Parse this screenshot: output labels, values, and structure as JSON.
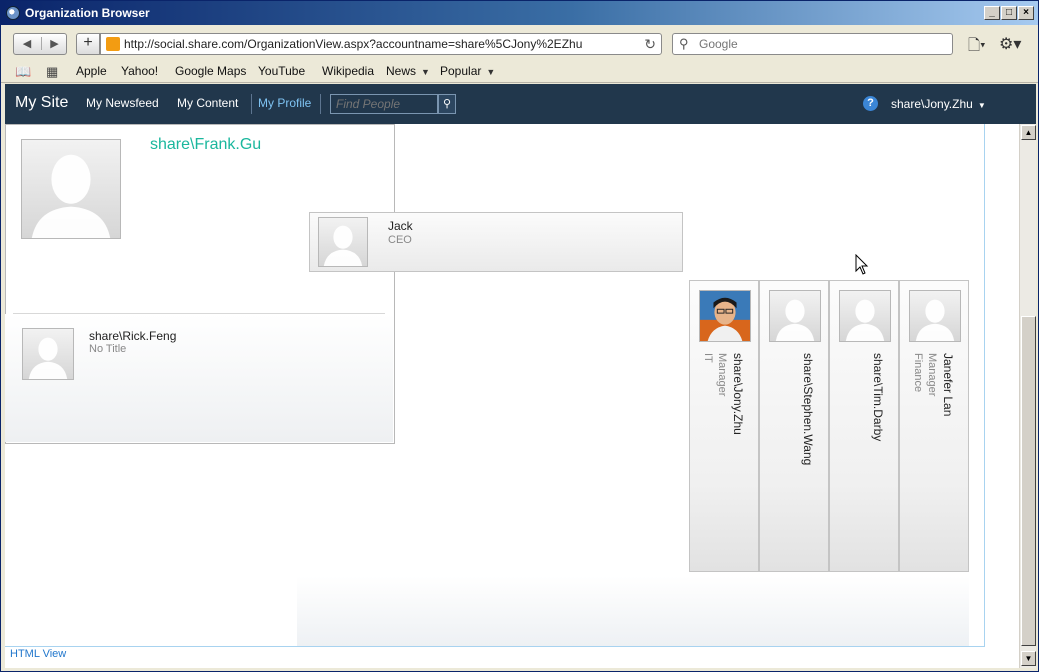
{
  "window": {
    "title": "Organization Browser",
    "controls": [
      "_",
      "□",
      "×"
    ]
  },
  "toolbar": {
    "url": "http://social.share.com/OrganizationView.aspx?accountname=share%5CJony%2EZhu",
    "search_placeholder": "Google"
  },
  "bookmarks": [
    {
      "label": "Apple"
    },
    {
      "label": "Yahoo!"
    },
    {
      "label": "Google Maps"
    },
    {
      "label": "YouTube"
    },
    {
      "label": "Wikipedia"
    },
    {
      "label": "News",
      "dropdown": true
    },
    {
      "label": "Popular",
      "dropdown": true
    }
  ],
  "sp_nav": {
    "site_title": "My Site",
    "links": [
      "My Newsfeed",
      "My Content",
      "My Profile"
    ],
    "active_link": "My Profile",
    "find_placeholder": "Find People",
    "user": "share\\Jony.Zhu"
  },
  "org": {
    "manager": {
      "name": "Jack",
      "title": "CEO"
    },
    "focus": {
      "name": "share\\Frank.Gu"
    },
    "report": {
      "name": "share\\Rick.Feng",
      "title": "No Title"
    },
    "peers": [
      {
        "name": "share\\Jony.Zhu",
        "title": "Manager",
        "dept": "IT",
        "has_photo": true
      },
      {
        "name": "share\\Stephen.Wang",
        "title": "",
        "dept": "",
        "has_photo": false
      },
      {
        "name": "share\\Tim.Darby",
        "title": "",
        "dept": "",
        "has_photo": false
      },
      {
        "name": "Janefer Lan",
        "title": "Manager",
        "dept": "Finance",
        "has_photo": false
      }
    ]
  },
  "footer": {
    "html_view": "HTML View"
  },
  "colors": {
    "nav_bg": "#21374c",
    "focus_name": "#1ab79d",
    "link": "#2277cc",
    "active_nav": "#7fc3f2"
  }
}
